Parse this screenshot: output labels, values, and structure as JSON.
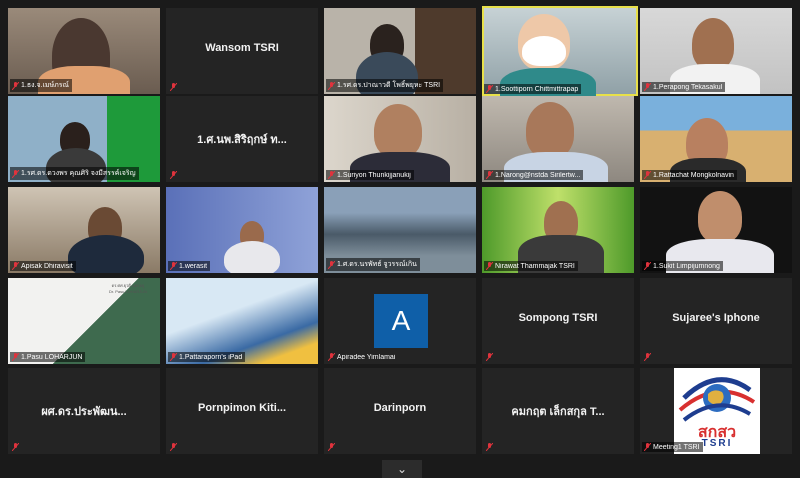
{
  "participants": [
    {
      "caption": "1.ธง.จ.เมษ์ภรณ์",
      "label": ""
    },
    {
      "caption": "",
      "label": "Wansom TSRI"
    },
    {
      "caption": "1.รศ.ดร.ปาณาวดี โพธิ์พยุหะ TSRI",
      "label": ""
    },
    {
      "caption": "1.Soottiporn Chittmittrapap",
      "label": ""
    },
    {
      "caption": "1.Perapong Tekasakul",
      "label": ""
    },
    {
      "caption": "1.รศ.ดร.ดวงพร คุณศิริ จงมีสรรค์เจริญ",
      "label": ""
    },
    {
      "caption": "",
      "label": "1.ศ.นพ.สิริฤกษ์ ท..."
    },
    {
      "caption": "1.Suriyon Thunkijjanukij",
      "label": ""
    },
    {
      "caption": "1.Narong@nstda Sirilertw...",
      "label": ""
    },
    {
      "caption": "1.Rattachat Mongkolnavin",
      "label": ""
    },
    {
      "caption": "Apisak Dhiravisit",
      "label": ""
    },
    {
      "caption": "1.werasit",
      "label": ""
    },
    {
      "caption": "1.ศ.ดร.นรพัทธ์ จูวรรณ์เกิน",
      "label": ""
    },
    {
      "caption": "Nirawat Thammajak TSRI",
      "label": ""
    },
    {
      "caption": "1.Sukit Limpijumnong",
      "label": ""
    },
    {
      "caption": "1.Pasu LOHARJUN",
      "label": ""
    },
    {
      "caption": "1.Pattaraporn's iPad",
      "label": ""
    },
    {
      "caption": "Apiradee Yimlamai",
      "label": "",
      "avatar_letter": "A"
    },
    {
      "caption": "",
      "label": "Sompong TSRI"
    },
    {
      "caption": "",
      "label": "Sujaree's Iphone"
    },
    {
      "caption": "",
      "label": "ผศ.ดร.ประพัฒน..."
    },
    {
      "caption": "",
      "label": "Pornpimon  Kiti..."
    },
    {
      "caption": "",
      "label": "Darinporn"
    },
    {
      "caption": "",
      "label": "คมกฤต เล็กสกุล T..."
    },
    {
      "caption": "Meeting1 TSRI",
      "label": ""
    }
  ],
  "logo_tsri": {
    "thai": "สกสว",
    "latin": "TSRI"
  },
  "overlays": {
    "pasu_sign_top": "ดร.ศศ.ยุวดี.นครอยู",
    "pasu_sign_bottom": "Dr. Pasu LOHARJUN"
  },
  "controls": {
    "toggle_icon": "chevron-down-icon",
    "toggle_glyph": "⌄"
  },
  "colors": {
    "active_speaker": "#e8e04a",
    "mic_muted": "#e0333d",
    "avatar_bg": "#0f5fa8"
  }
}
